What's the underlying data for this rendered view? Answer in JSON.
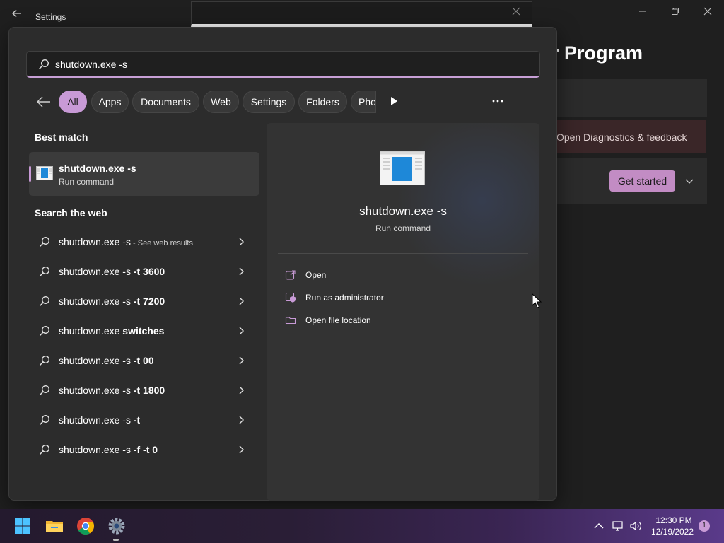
{
  "settings": {
    "title": "Settings",
    "heading": "r Program",
    "diagnostics_link": "Open Diagnostics & feedback",
    "get_started_label": "Get started"
  },
  "search": {
    "query": "shutdown.exe -s",
    "filters": [
      {
        "label": "All",
        "active": true
      },
      {
        "label": "Apps"
      },
      {
        "label": "Documents"
      },
      {
        "label": "Web"
      },
      {
        "label": "Settings"
      },
      {
        "label": "Folders"
      },
      {
        "label": "Pho"
      }
    ]
  },
  "best_match": {
    "section_label": "Best match",
    "title": "shutdown.exe -s",
    "subtitle": "Run command"
  },
  "web": {
    "section_label": "Search the web",
    "items": [
      {
        "base": "shutdown.exe -s",
        "bold": "",
        "hint": " - See web results"
      },
      {
        "base": "shutdown.exe -s",
        "bold": " -t 3600",
        "hint": ""
      },
      {
        "base": "shutdown.exe -s",
        "bold": " -t 7200",
        "hint": ""
      },
      {
        "base": "shutdown.exe",
        "bold": " switches",
        "hint": ""
      },
      {
        "base": "shutdown.exe -s",
        "bold": " -t 00",
        "hint": ""
      },
      {
        "base": "shutdown.exe -s",
        "bold": " -t 1800",
        "hint": ""
      },
      {
        "base": "shutdown.exe -s",
        "bold": " -t",
        "hint": ""
      },
      {
        "base": "shutdown.exe -s",
        "bold": " -f -t 0",
        "hint": ""
      }
    ]
  },
  "preview": {
    "title": "shutdown.exe -s",
    "subtitle": "Run command",
    "actions": [
      {
        "label": "Open",
        "icon": "open-external-icon"
      },
      {
        "label": "Run as administrator",
        "icon": "admin-shield-icon"
      },
      {
        "label": "Open file location",
        "icon": "folder-icon"
      }
    ]
  },
  "taskbar": {
    "time": "12:30 PM",
    "date": "12/19/2022",
    "notification_count": "1"
  },
  "colors": {
    "accent": "#c89ad6",
    "panel": "#2c2c2c",
    "preview": "#333333"
  }
}
